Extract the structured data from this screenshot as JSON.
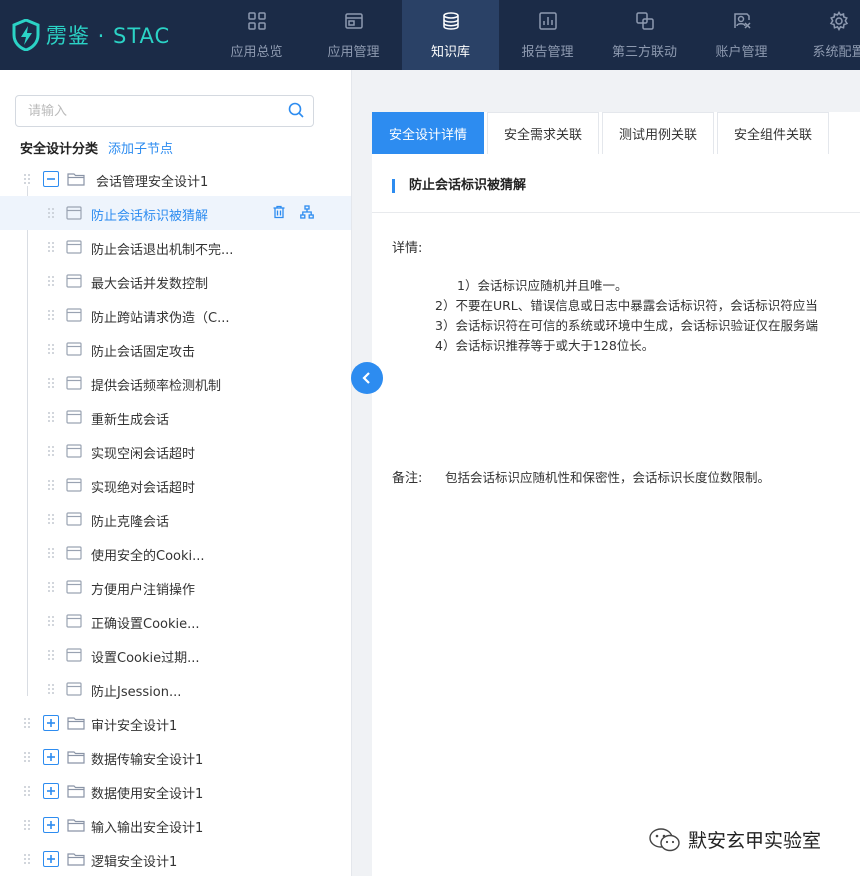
{
  "app": {
    "logo_text": "雳鉴 · STAC"
  },
  "nav": [
    {
      "label": "应用总览",
      "icon": "grid-icon"
    },
    {
      "label": "应用管理",
      "icon": "window-icon"
    },
    {
      "label": "知识库",
      "icon": "database-icon",
      "active": true
    },
    {
      "label": "报告管理",
      "icon": "chart-icon"
    },
    {
      "label": "第三方联动",
      "icon": "link-icon"
    },
    {
      "label": "账户管理",
      "icon": "user-card-icon"
    },
    {
      "label": "系统配置",
      "icon": "gear-icon"
    }
  ],
  "sidebar": {
    "search_placeholder": "请输入",
    "tree_title": "安全设计分类",
    "add_child": "添加子节点",
    "root": {
      "label": "会话管理安全设计1",
      "expanded": true
    },
    "children": [
      "防止会话标识被猜解",
      "防止会话退出机制不完...",
      "最大会话并发数控制",
      "防止跨站请求伪造（C...",
      "防止会话固定攻击",
      "提供会话频率检测机制",
      "重新生成会话",
      "实现空闲会话超时",
      "实现绝对会话超时",
      "防止克隆会话",
      "使用安全的Cooki...",
      "方便用户注销操作",
      "正确设置Cookie...",
      "设置Cookie过期...",
      "防止Jsession..."
    ],
    "selected_index": 0,
    "collapsed_roots": [
      "审计安全设计1",
      "数据传输安全设计1",
      "数据使用安全设计1",
      "输入输出安全设计1",
      "逻辑安全设计1"
    ]
  },
  "tabs": [
    "安全设计详情",
    "安全需求关联",
    "测试用例关联",
    "安全组件关联"
  ],
  "detail": {
    "title": "防止会话标识被猜解",
    "detail_label": "详情:",
    "lines": [
      "1）会话标识应随机并且唯一。",
      "2）不要在URL、错误信息或日志中暴露会话标识符，会话标识符应当",
      "3）会话标识符在可信的系统或环境中生成，会话标识验证仅在服务端",
      "4）会话标识推荐等于或大于128位长。"
    ],
    "note_label": "备注:",
    "note_text": "包括会话标识应随机性和保密性，会话标识长度位数限制。"
  },
  "watermark": "默安玄甲实验室",
  "colors": {
    "topbar": "#1b2b47",
    "accent": "#2d8cf0",
    "logo": "#2bd3c6"
  }
}
